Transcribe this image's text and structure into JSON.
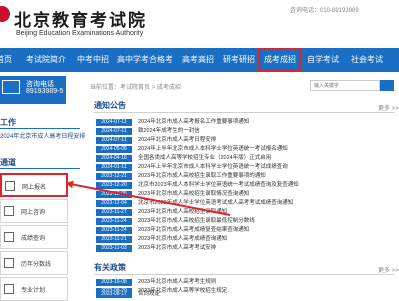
{
  "header": {
    "logo_cn": "北京教育考试院",
    "logo_en": "Beijing Education Examinations Authority",
    "hotline": "咨询电话：010-89193989"
  },
  "nav": {
    "items": [
      "首页",
      "考试院简介",
      "中考中招",
      "高中学考合格考",
      "高考高招",
      "研考研招",
      "成考成招",
      "自学考试",
      "社会考试"
    ],
    "active_index": 6
  },
  "left": {
    "consult": {
      "label": "咨询电话",
      "number": "89193989-5"
    },
    "work_title": "工作",
    "work_note": "2024年北京市成人高考日程安排",
    "quick_title": "通道",
    "quick_items": [
      "网上报名",
      "网上咨询",
      "成绩查询",
      "历年分数线",
      "专业计划"
    ]
  },
  "main": {
    "breadcrumb": "当前位置：考试院首页 > 成考成招",
    "search_placeholder": "输入关键字",
    "notice_title": "通知公告",
    "notice_more": "更多 >>",
    "notices": [
      {
        "date": "2024-07-11",
        "title": "2024年北京市成人高考报名工作重要事项通知"
      },
      {
        "date": "2024-07-11",
        "title": "致2024年成考生的一封信"
      },
      {
        "date": "2024-07-11",
        "title": "2024年北京市成人高考日程安排"
      },
      {
        "date": "2024-05-06",
        "title": "2024年上半年北京市成人本科学士学位英语统一考试报名通知"
      },
      {
        "date": "2024-04-16",
        "title": "全国各类成人高等学校招生专业（2024年版）正式启用"
      },
      {
        "date": "2024-01-11",
        "title": "2024年上半年北京市成人本科学士学位英语统一考试成绩查询"
      },
      {
        "date": "2023-12-21",
        "title": "2023年北京市成人高校招生录取工作重要事项的通知"
      },
      {
        "date": "2023-12-20",
        "title": "北京市2023年成人本科学士学位英语统一考试成绩查询及复查通知"
      },
      {
        "date": "2023-12-05",
        "title": "2023年北京市成人高校招生录取情况查询通知"
      },
      {
        "date": "2023-12-04",
        "title": "北京市2023年成人学士学位英语考试成人高考考试成绩查询通知"
      },
      {
        "date": "2023-11-27",
        "title": "2023年北京市成人高校招生录取通知"
      },
      {
        "date": "2023-11-24",
        "title": "2023年北京市成人高校招生录取最低控制分数线"
      },
      {
        "date": "2023-11-24",
        "title": "2023年北京市成人高考成绩复查结果查询通知"
      },
      {
        "date": "2023-11-21",
        "title": "2023年北京市成人高考成绩查询通知"
      },
      {
        "date": "2023-11-03",
        "title": "2023年北京市成人高考考试安排"
      }
    ],
    "policy_title": "有关政策",
    "policy_more": "更多 >>",
    "policies": [
      {
        "date": "2023-10-08",
        "title": "2023年北京市成人高考考生规则"
      },
      {
        "date": "2023-08-29",
        "title": "2023年北京市成人高等学校招生规定"
      },
      {
        "date": "2023-08-17",
        "title": "合同规定"
      }
    ]
  },
  "colors": {
    "nav_blue": "#1a6fc4",
    "highlight_red": "#e0242b"
  }
}
